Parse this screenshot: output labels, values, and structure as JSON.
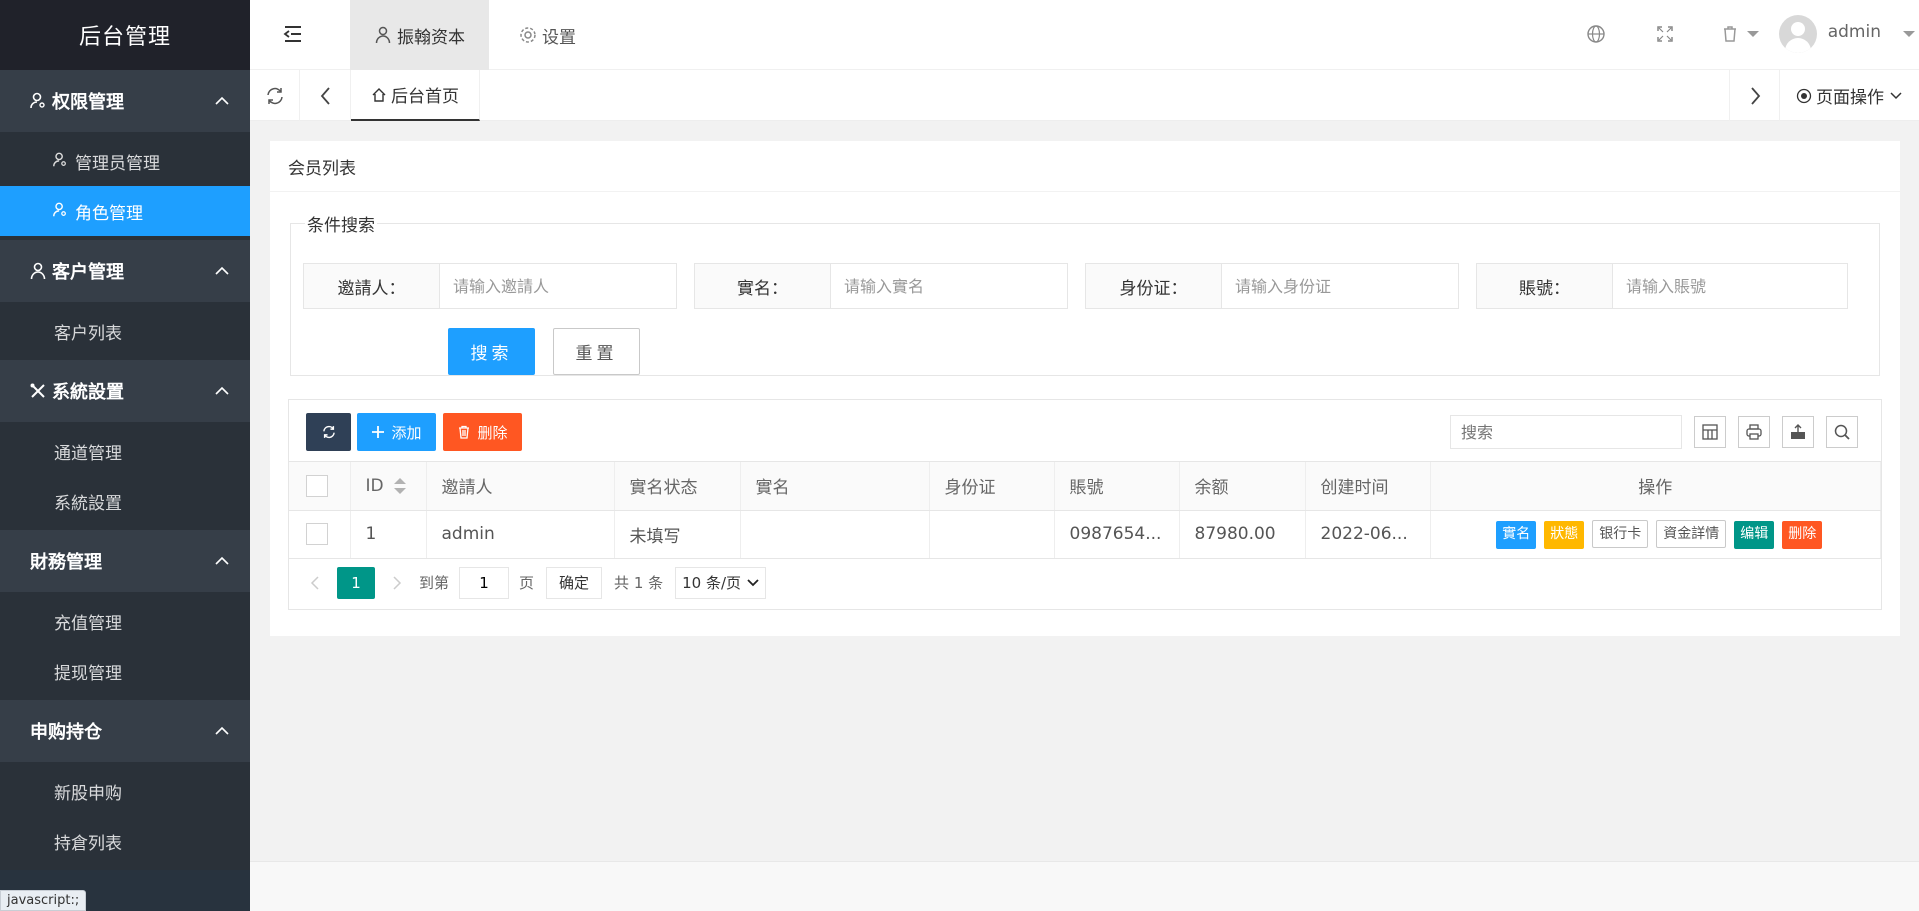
{
  "sidebar": {
    "logo": "后台管理",
    "groups": [
      {
        "title": "权限管理",
        "items": [
          "管理员管理",
          "角色管理"
        ]
      },
      {
        "title": "客户管理",
        "items": [
          "客户列表"
        ]
      },
      {
        "title": "系統設置",
        "items": [
          "通道管理",
          "系統設置"
        ]
      },
      {
        "title": "財務管理",
        "items": [
          "充值管理",
          "提现管理"
        ]
      },
      {
        "title": "申购持仓",
        "items": [
          "新股申购",
          "持倉列表"
        ]
      }
    ],
    "status_tip": "javascript:;"
  },
  "header": {
    "tabs": [
      "振翰资本",
      "设置"
    ],
    "user": "admin"
  },
  "tabsbar": {
    "home_tab": "后台首页",
    "page_ops": "页面操作"
  },
  "card": {
    "title": "会员列表",
    "search": {
      "legend": "条件搜索",
      "fields": [
        {
          "label": "邀請人：",
          "placeholder": "请输入邀請人"
        },
        {
          "label": "實名：",
          "placeholder": "请输入實名"
        },
        {
          "label": "身份证：",
          "placeholder": "请输入身份证"
        },
        {
          "label": "賬號：",
          "placeholder": "请输入賬號"
        }
      ],
      "search_btn": "搜索",
      "reset_btn": "重置"
    },
    "toolbar": {
      "add": "添加",
      "delete": "删除",
      "search_placeholder": "搜索"
    },
    "table": {
      "headers": [
        "ID",
        "邀請人",
        "實名状态",
        "實名",
        "身份证",
        "賬號",
        "余额",
        "创建时间",
        "操作"
      ],
      "rows": [
        {
          "id": "1",
          "inviter": "admin",
          "status": "未填写",
          "name": "",
          "idcard": "",
          "account": "0987654...",
          "balance": "87980.00",
          "created": "2022-06..."
        }
      ],
      "actions": [
        "實名",
        "狀態",
        "银行卡",
        "資金詳情",
        "编辑",
        "删除"
      ]
    },
    "pager": {
      "current": "1",
      "goto_label": "到第",
      "goto_value": "1",
      "page_unit": "页",
      "ok": "确定",
      "total": "共 1 条",
      "per_page": "10 条/页"
    }
  },
  "colors": {
    "sidebar_bg": "#28333e",
    "primary": "#1e9fff",
    "green": "#009688",
    "orange": "#ffb800",
    "red": "#ff5722",
    "toolbar_dark": "#2f4056"
  }
}
